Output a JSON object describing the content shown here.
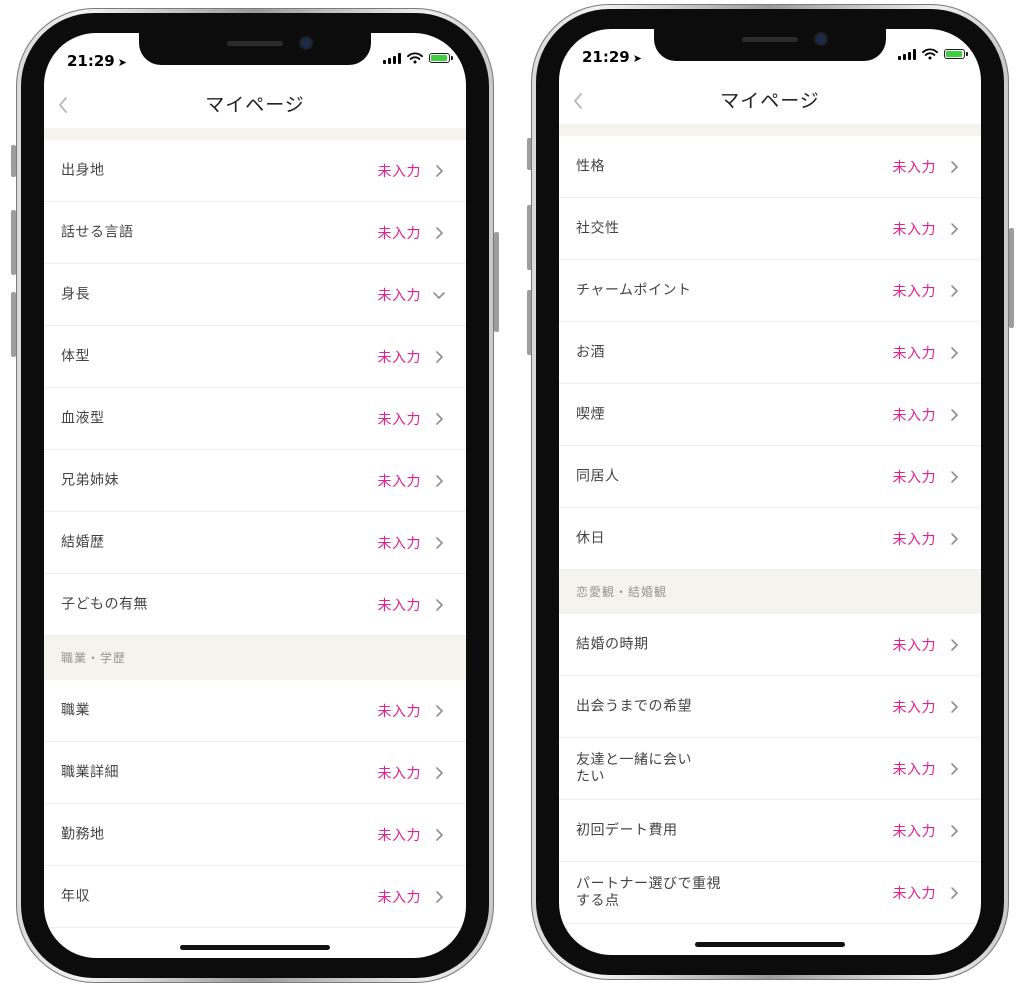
{
  "accent_color": "#e4208a",
  "screens": [
    {
      "status": {
        "time": "21:29"
      },
      "nav": {
        "title": "マイページ"
      },
      "rows": [
        {
          "label": "出身地",
          "value": "未入力"
        },
        {
          "label": "話せる言語",
          "value": "未入力"
        },
        {
          "label": "身長",
          "value": "未入力"
        },
        {
          "label": "体型",
          "value": "未入力"
        },
        {
          "label": "血液型",
          "value": "未入力"
        },
        {
          "label": "兄弟姉妹",
          "value": "未入力"
        },
        {
          "label": "結婚歴",
          "value": "未入力"
        },
        {
          "label": "子どもの有無",
          "value": "未入力"
        },
        {
          "label": "職業",
          "value": "未入力"
        },
        {
          "label": "職業詳細",
          "value": "未入力"
        },
        {
          "label": "勤務地",
          "value": "未入力"
        },
        {
          "label": "年収",
          "value": "未入力"
        }
      ],
      "sections": [
        "職業・学歴"
      ]
    },
    {
      "status": {
        "time": "21:29"
      },
      "nav": {
        "title": "マイページ"
      },
      "rows": [
        {
          "label": "性格",
          "value": "未入力"
        },
        {
          "label": "社交性",
          "value": "未入力"
        },
        {
          "label": "チャームポイント",
          "value": "未入力"
        },
        {
          "label": "お酒",
          "value": "未入力"
        },
        {
          "label": "喫煙",
          "value": "未入力"
        },
        {
          "label": "同居人",
          "value": "未入力"
        },
        {
          "label": "休日",
          "value": "未入力"
        },
        {
          "label": "結婚の時期",
          "value": "未入力"
        },
        {
          "label": "出会うまでの希望",
          "value": "未入力"
        },
        {
          "label": "友達と一緒に会いたい",
          "value": "未入力"
        },
        {
          "label": "初回デート費用",
          "value": "未入力"
        },
        {
          "label": "パートナー選びで重視する点",
          "value": "未入力"
        }
      ],
      "sections": [
        "恋愛観・結婚観"
      ]
    }
  ]
}
